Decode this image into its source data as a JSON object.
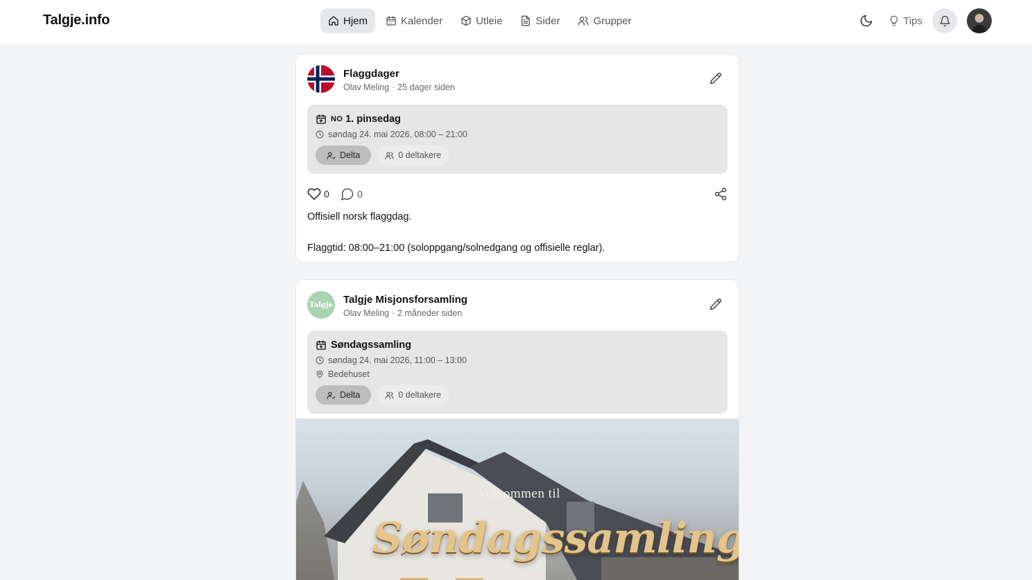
{
  "header": {
    "brand": "Talgje.info",
    "nav": [
      {
        "label": "Hjem",
        "icon": "home-icon",
        "active": true
      },
      {
        "label": "Kalender",
        "icon": "calendar-icon"
      },
      {
        "label": "Utleie",
        "icon": "box-icon"
      },
      {
        "label": "Sider",
        "icon": "file-icon"
      },
      {
        "label": "Grupper",
        "icon": "users-icon"
      }
    ],
    "tips_label": "Tips"
  },
  "posts": [
    {
      "title": "Flaggdager",
      "author": "Olav Meling",
      "time_ago": "25 dager siden",
      "event": {
        "flag_code": "NO",
        "title": "1. pinsedag",
        "datetime": "søndag 24. mai 2026, 08:00 – 21:00",
        "join_label": "Delta",
        "participants_label": "0 deltakere"
      },
      "likes": "0",
      "comments": "0",
      "body": [
        "Offisiell norsk flaggdag.",
        "Flaggtid: 08:00–21:00 (soloppgang/solnedgang og offisielle reglar)."
      ]
    },
    {
      "title": "Talgje Misjonsforsamling",
      "avatar_text": "Talgje",
      "author": "Olav Meling",
      "time_ago": "2 måneder siden",
      "event": {
        "title": "Søndagssamling",
        "datetime": "søndag 24. mai 2026, 11:00 – 13:00",
        "location": "Bedehuset",
        "join_label": "Delta",
        "participants_label": "0 deltakere"
      },
      "image": {
        "subtitle": "Velkommen til",
        "title": "Søndagssamling"
      }
    }
  ],
  "colors": {
    "page_bg": "#f3f4f6",
    "event_box": "#e6e6e6",
    "flag_red": "#ba0c2f",
    "flag_blue": "#00205b",
    "group_avatar": "#a8d5b0",
    "accent_gold": "#e4c48a"
  }
}
